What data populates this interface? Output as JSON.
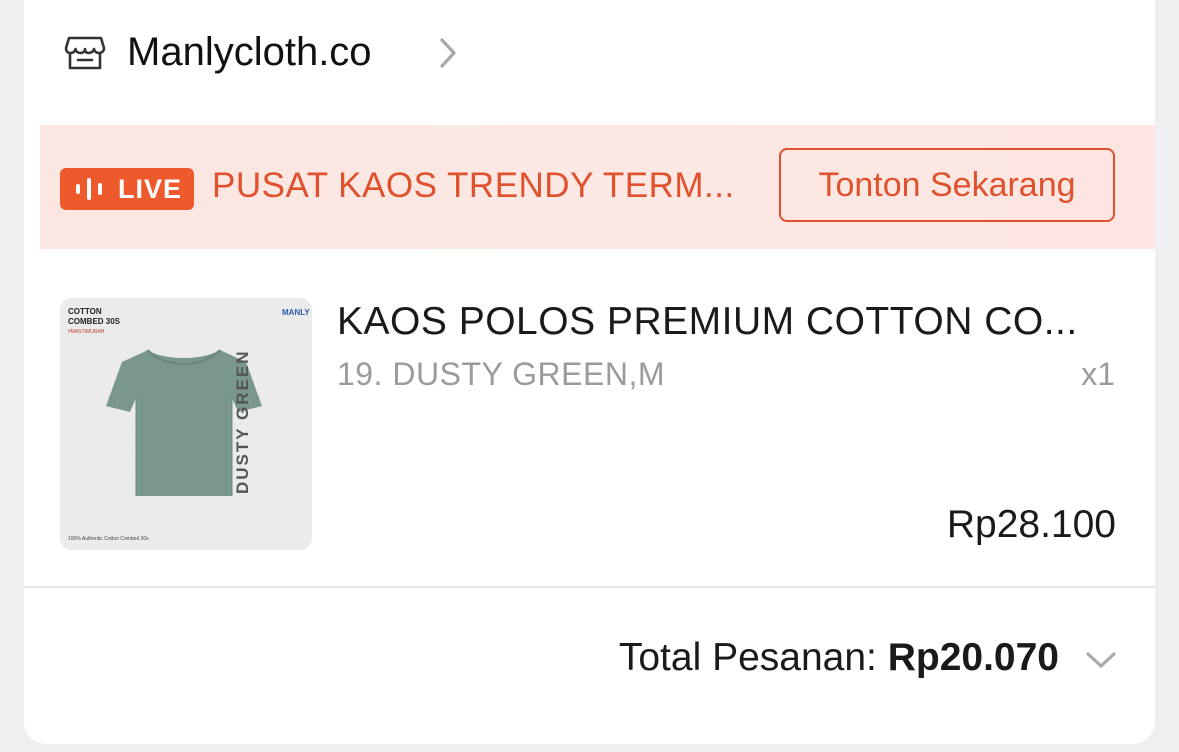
{
  "shop": {
    "name": "Manlycloth.co",
    "icon": "store-icon",
    "chevron_icon": "chevron-right-icon"
  },
  "live": {
    "badge_label": "LIVE",
    "badge_icon": "live-bars-icon",
    "title": "PUSAT KAOS TRENDY TERM...",
    "watch_button_label": "Tonton Sekarang",
    "accent_color": "#ee5a2c"
  },
  "product": {
    "name": "KAOS POLOS PREMIUM COTTON CO...",
    "variant": "19. DUSTY GREEN,M",
    "quantity": "x1",
    "price": "Rp28.100",
    "image": {
      "label_top": "COTTON",
      "label_top2": "COMBED 30S",
      "hashtag": "#MASTIMURAH",
      "brand": "MANLY",
      "vertical_text": "DUSTY GREEN",
      "footer": "100% Authentic Cotton Combed 30s",
      "shirt_color": "#7a978e"
    }
  },
  "total": {
    "label": "Total Pesanan:",
    "value": "Rp20.070",
    "chevron_icon": "chevron-down-icon"
  }
}
